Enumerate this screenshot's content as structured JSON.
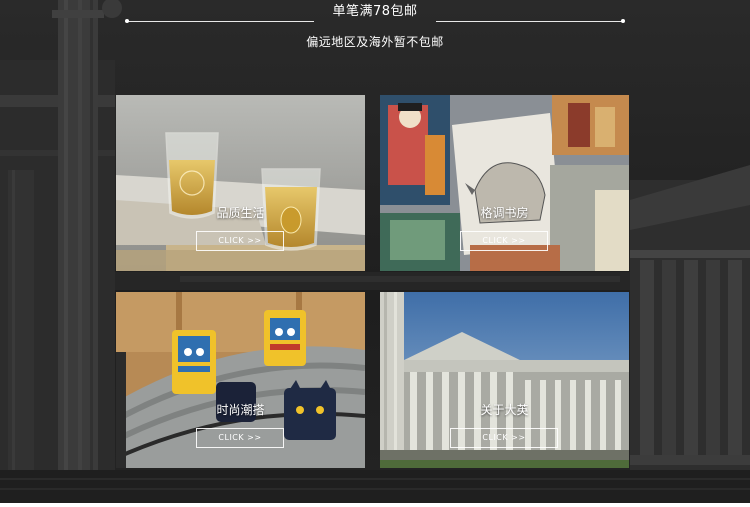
{
  "header": {
    "promo_text": "单笔满78包邮",
    "note_text": "偏远地区及海外暂不包邮"
  },
  "tiles": [
    {
      "title": "品质生活",
      "button_label": "CLICK >>"
    },
    {
      "title": "格调书房",
      "button_label": "CLICK >>"
    },
    {
      "title": "时尚潮搭",
      "button_label": "CLICK >>"
    },
    {
      "title": "关于大英",
      "button_label": "CLICK >>"
    }
  ],
  "colors": {
    "background": "#232323",
    "text": "#ffffff"
  }
}
